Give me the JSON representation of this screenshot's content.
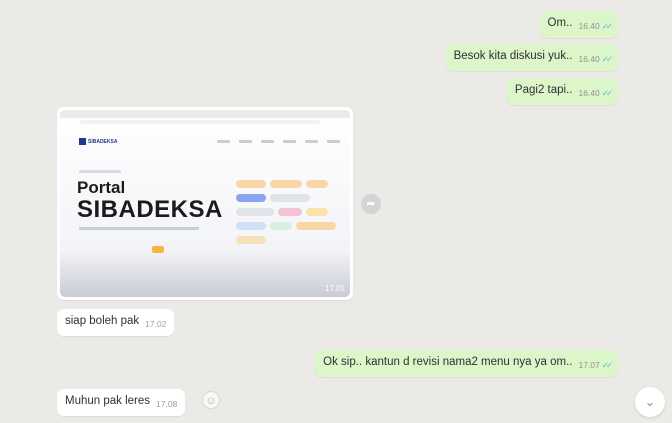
{
  "messages": [
    {
      "direction": "out",
      "text": "Om..",
      "time": "16.40"
    },
    {
      "direction": "out",
      "text": "Besok kita diskusi yuk..",
      "time": "16.40"
    },
    {
      "direction": "out",
      "text": "Pagi2 tapi..",
      "time": "16.40"
    },
    {
      "direction": "in",
      "type": "image",
      "time": "17.01"
    },
    {
      "direction": "in",
      "text": "siap boleh pak",
      "time": "17.02"
    },
    {
      "direction": "out",
      "text": "Ok sip.. kantun d revisi nama2 menu nya ya om..",
      "time": "17.07"
    },
    {
      "direction": "in",
      "text": "Muhun pak leres",
      "time": "17.08"
    }
  ],
  "image_preview": {
    "portal_line1": "Portal",
    "portal_line2": "SIBADEKSA",
    "logo_text": "SIBADEKSA",
    "pill_colors": [
      "#f9d6a8",
      "#f9d6a8",
      "#f9d6a8",
      "#8aa3f0",
      "#dfe3ea",
      "#dfe3ea",
      "#f2c4d3",
      "#f9e3a8",
      "#cfe0f7",
      "#d9f0dc",
      "#f9d6a8",
      "#f6e0b5"
    ]
  },
  "colors": {
    "outgoing_bubble": "#dcf5c9",
    "incoming_bubble": "#ffffff",
    "read_ticks": "#59b6e8",
    "cta": "#f6b73c"
  },
  "icons": {
    "read_receipt": "double-check-icon",
    "share": "forward-icon",
    "react": "emoji-icon",
    "scroll_down": "chevron-down-icon"
  }
}
